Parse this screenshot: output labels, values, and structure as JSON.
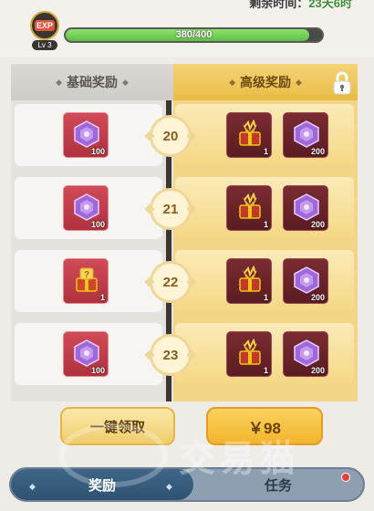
{
  "header": {
    "time_label": "剩余时间：",
    "time_value": "23天6时",
    "exp_badge": "EXP",
    "level": "Lv 3",
    "xp_text": "380/400",
    "xp_progress": 0.95
  },
  "tabs_header": {
    "basic": "基础奖励",
    "premium": "高级奖励",
    "lock_icon": "lock-icon"
  },
  "rows": [
    {
      "level": "20",
      "basic": {
        "icon": "purple-gem-icon",
        "qty": "100"
      },
      "premium": [
        {
          "icon": "gift-box-icon",
          "qty": "1"
        },
        {
          "icon": "purple-gem-icon",
          "qty": "200"
        }
      ]
    },
    {
      "level": "21",
      "basic": {
        "icon": "purple-gem-icon",
        "qty": "100"
      },
      "premium": [
        {
          "icon": "gift-box-icon",
          "qty": "1"
        },
        {
          "icon": "purple-gem-icon",
          "qty": "200"
        }
      ]
    },
    {
      "level": "22",
      "basic": {
        "icon": "mystery-gift-icon",
        "qty": "1"
      },
      "premium": [
        {
          "icon": "gift-box-icon",
          "qty": "1"
        },
        {
          "icon": "purple-gem-icon",
          "qty": "200"
        }
      ]
    },
    {
      "level": "23",
      "basic": {
        "icon": "purple-gem-icon",
        "qty": "100"
      },
      "premium": [
        {
          "icon": "gift-box-icon",
          "qty": "1"
        },
        {
          "icon": "purple-gem-icon",
          "qty": "200"
        }
      ]
    }
  ],
  "actions": {
    "claim_all": "一键领取",
    "buy_price": "￥98"
  },
  "watermark": "交易猫",
  "bottom_tabs": {
    "rewards": "奖励",
    "tasks": "任务"
  },
  "colors": {
    "premium_gold": "#f0d686",
    "basic_grey": "#e5e1dc",
    "active_tab": "#2f5272",
    "xp_fill": "#5dbf45"
  }
}
